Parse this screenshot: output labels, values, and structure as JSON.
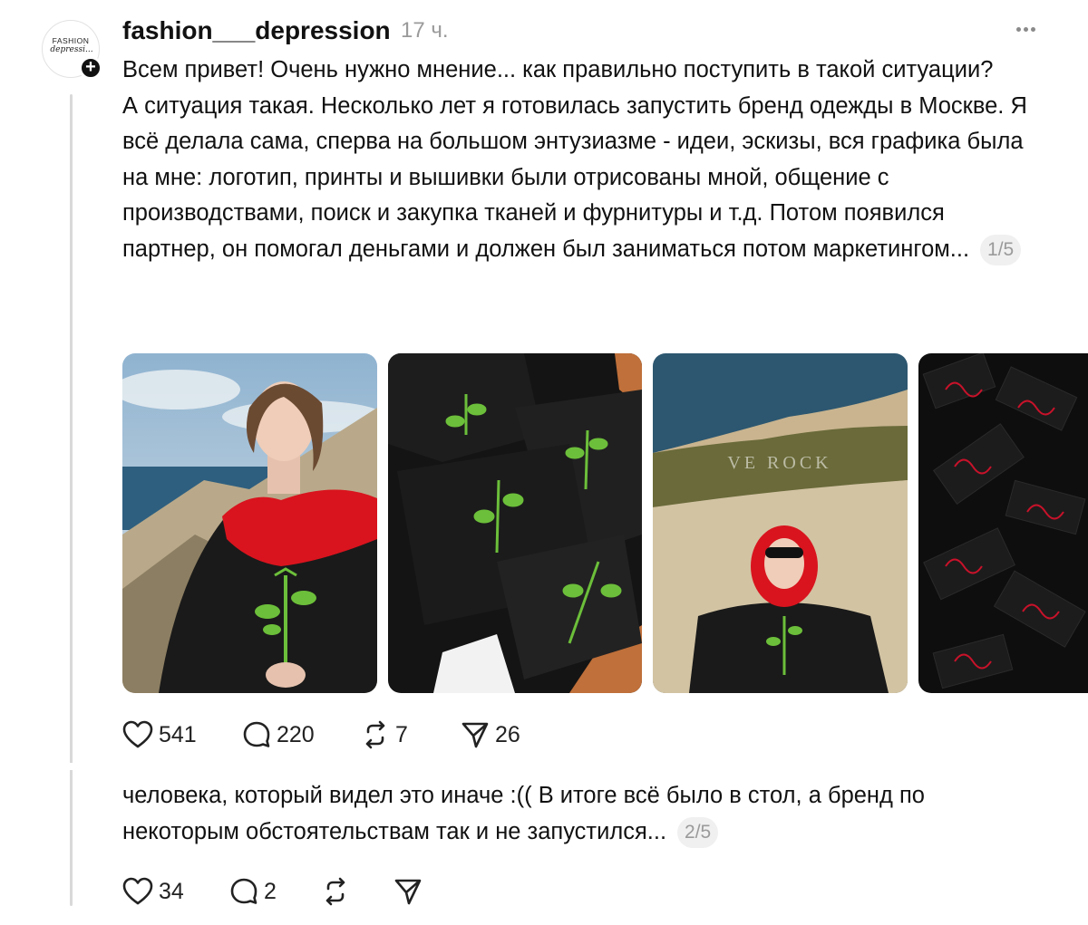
{
  "post": {
    "username": "fashion___depression",
    "time": "17 ч.",
    "avatar_line1": "FASHION",
    "avatar_line2": "depressi...",
    "paragraph1": "Всем привет! Очень нужно мнение... как правильно поступить в такой ситуации?",
    "paragraph2": "А ситуация такая. Несколько лет я готовилась запустить бренд одежды в Москве. Я всё делала сама, сперва на большом энтузиазме - идеи, эскизы, вся графика была на мне: логотип, принты и вышивки были отрисованы мной, общение с производствами, поиск и закупка тканей и фурнитуры и т.д. Потом появился партнер, он помогал деньгами и должен был заниматься потом маркетингом...",
    "counter": "1/5",
    "photo3_watermark": "VE ROCK",
    "likes": "541",
    "comments": "220",
    "reposts": "7",
    "shares": "26"
  },
  "reply": {
    "text": "человека, который видел это иначе :(( В итоге всё было в стол, а бренд по некоторым обстоятельствам так и не запустился...",
    "counter": "2/5",
    "likes": "34",
    "comments": "2"
  },
  "colors": {
    "text": "#111111",
    "muted": "#9a9a9a",
    "thread_line": "#d9d9d9",
    "hoodie_red": "#d9141e",
    "embroidery_green": "#6cbf3a"
  }
}
